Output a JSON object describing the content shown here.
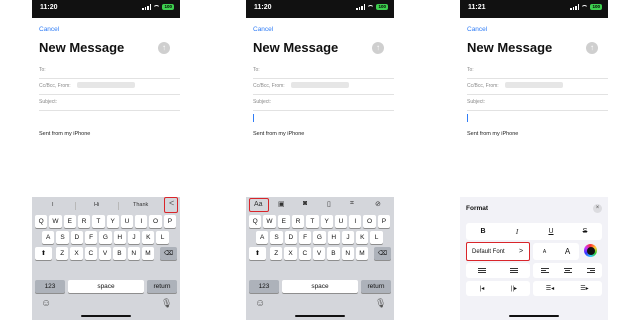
{
  "screens": [
    {
      "status_time": "11:20",
      "battery": "100",
      "cancel": "Cancel",
      "title": "New Message",
      "to_label": "To:",
      "cc_label": "Cc/Bcc, From:",
      "subject_label": "Subject:",
      "signature": "Sent from my iPhone"
    },
    {
      "status_time": "11:20",
      "battery": "100",
      "cancel": "Cancel",
      "title": "New Message",
      "to_label": "To:",
      "cc_label": "Cc/Bcc, From:",
      "subject_label": "Subject:",
      "signature": "Sent from my iPhone"
    },
    {
      "status_time": "11:21",
      "battery": "100",
      "cancel": "Cancel",
      "title": "New Message",
      "to_label": "To:",
      "cc_label": "Cc/Bcc, From:",
      "subject_label": "Subject:",
      "signature": "Sent from my iPhone"
    }
  ],
  "keyboard1": {
    "quicktype": [
      "I",
      "Hi",
      "Thank"
    ],
    "expand_glyph": "<",
    "row1": [
      "Q",
      "W",
      "E",
      "R",
      "T",
      "Y",
      "U",
      "I",
      "O",
      "P"
    ],
    "row2": [
      "A",
      "S",
      "D",
      "F",
      "G",
      "H",
      "J",
      "K",
      "L"
    ],
    "row3": [
      "Z",
      "X",
      "C",
      "V",
      "B",
      "N",
      "M"
    ],
    "numbers": "123",
    "space": "space",
    "return": "return"
  },
  "keyboard2": {
    "toolbar_aa": "Aa",
    "row1": [
      "Q",
      "W",
      "E",
      "R",
      "T",
      "Y",
      "U",
      "I",
      "O",
      "P"
    ],
    "row2": [
      "A",
      "S",
      "D",
      "F",
      "G",
      "H",
      "J",
      "K",
      "L"
    ],
    "row3": [
      "Z",
      "X",
      "C",
      "V",
      "B",
      "N",
      "M"
    ],
    "numbers": "123",
    "space": "space",
    "return": "return"
  },
  "format_panel": {
    "title": "Format",
    "close": "×",
    "bold": "B",
    "italic": "I",
    "underline": "U",
    "strike": "S",
    "font_button": "Default Font",
    "font_chevron": ">",
    "size_small": "A",
    "size_large": "A"
  },
  "colors": {
    "accent": "#2f7cf6",
    "highlight": "#d9252a",
    "keyboard_bg": "#d4d6db",
    "battery": "#3ecf4f"
  }
}
